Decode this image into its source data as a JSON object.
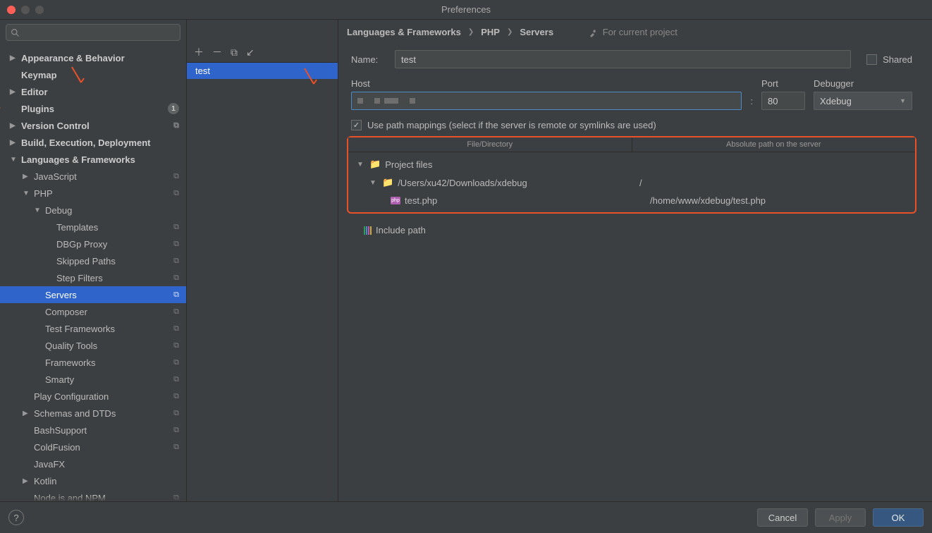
{
  "window": {
    "title": "Preferences"
  },
  "breadcrumb": {
    "items": [
      "Languages & Frameworks",
      "PHP",
      "Servers"
    ],
    "scope": "For current project"
  },
  "sidebar": {
    "items": [
      {
        "label": "Appearance & Behavior"
      },
      {
        "label": "Keymap"
      },
      {
        "label": "Editor"
      },
      {
        "label": "Plugins",
        "badge": "1"
      },
      {
        "label": "Version Control"
      },
      {
        "label": "Build, Execution, Deployment"
      },
      {
        "label": "Languages & Frameworks"
      },
      {
        "label": "JavaScript"
      },
      {
        "label": "PHP"
      },
      {
        "label": "Debug"
      },
      {
        "label": "Templates"
      },
      {
        "label": "DBGp Proxy"
      },
      {
        "label": "Skipped Paths"
      },
      {
        "label": "Step Filters"
      },
      {
        "label": "Servers"
      },
      {
        "label": "Composer"
      },
      {
        "label": "Test Frameworks"
      },
      {
        "label": "Quality Tools"
      },
      {
        "label": "Frameworks"
      },
      {
        "label": "Smarty"
      },
      {
        "label": "Play Configuration"
      },
      {
        "label": "Schemas and DTDs"
      },
      {
        "label": "BashSupport"
      },
      {
        "label": "ColdFusion"
      },
      {
        "label": "JavaFX"
      },
      {
        "label": "Kotlin"
      },
      {
        "label": "Node.js and NPM"
      }
    ]
  },
  "server_list": {
    "items": [
      "test"
    ]
  },
  "form": {
    "name_label": "Name:",
    "name_value": "test",
    "shared_label": "Shared",
    "host_label": "Host",
    "port_label": "Port",
    "port_value": "80",
    "debugger_label": "Debugger",
    "debugger_value": "Xdebug",
    "mappings_label": "Use path mappings (select if the server is remote or symlinks are used)",
    "columns": {
      "file_dir": "File/Directory",
      "abs_path": "Absolute path on the server"
    },
    "tree": {
      "project_files": "Project files",
      "project_root": "/Users/xu42/Downloads/xdebug",
      "project_root_remote": "/",
      "file_name": "test.php",
      "file_remote": "/home/www/xdebug/test.php",
      "include_path": "Include path"
    }
  },
  "footer": {
    "cancel": "Cancel",
    "apply": "Apply",
    "ok": "OK"
  }
}
